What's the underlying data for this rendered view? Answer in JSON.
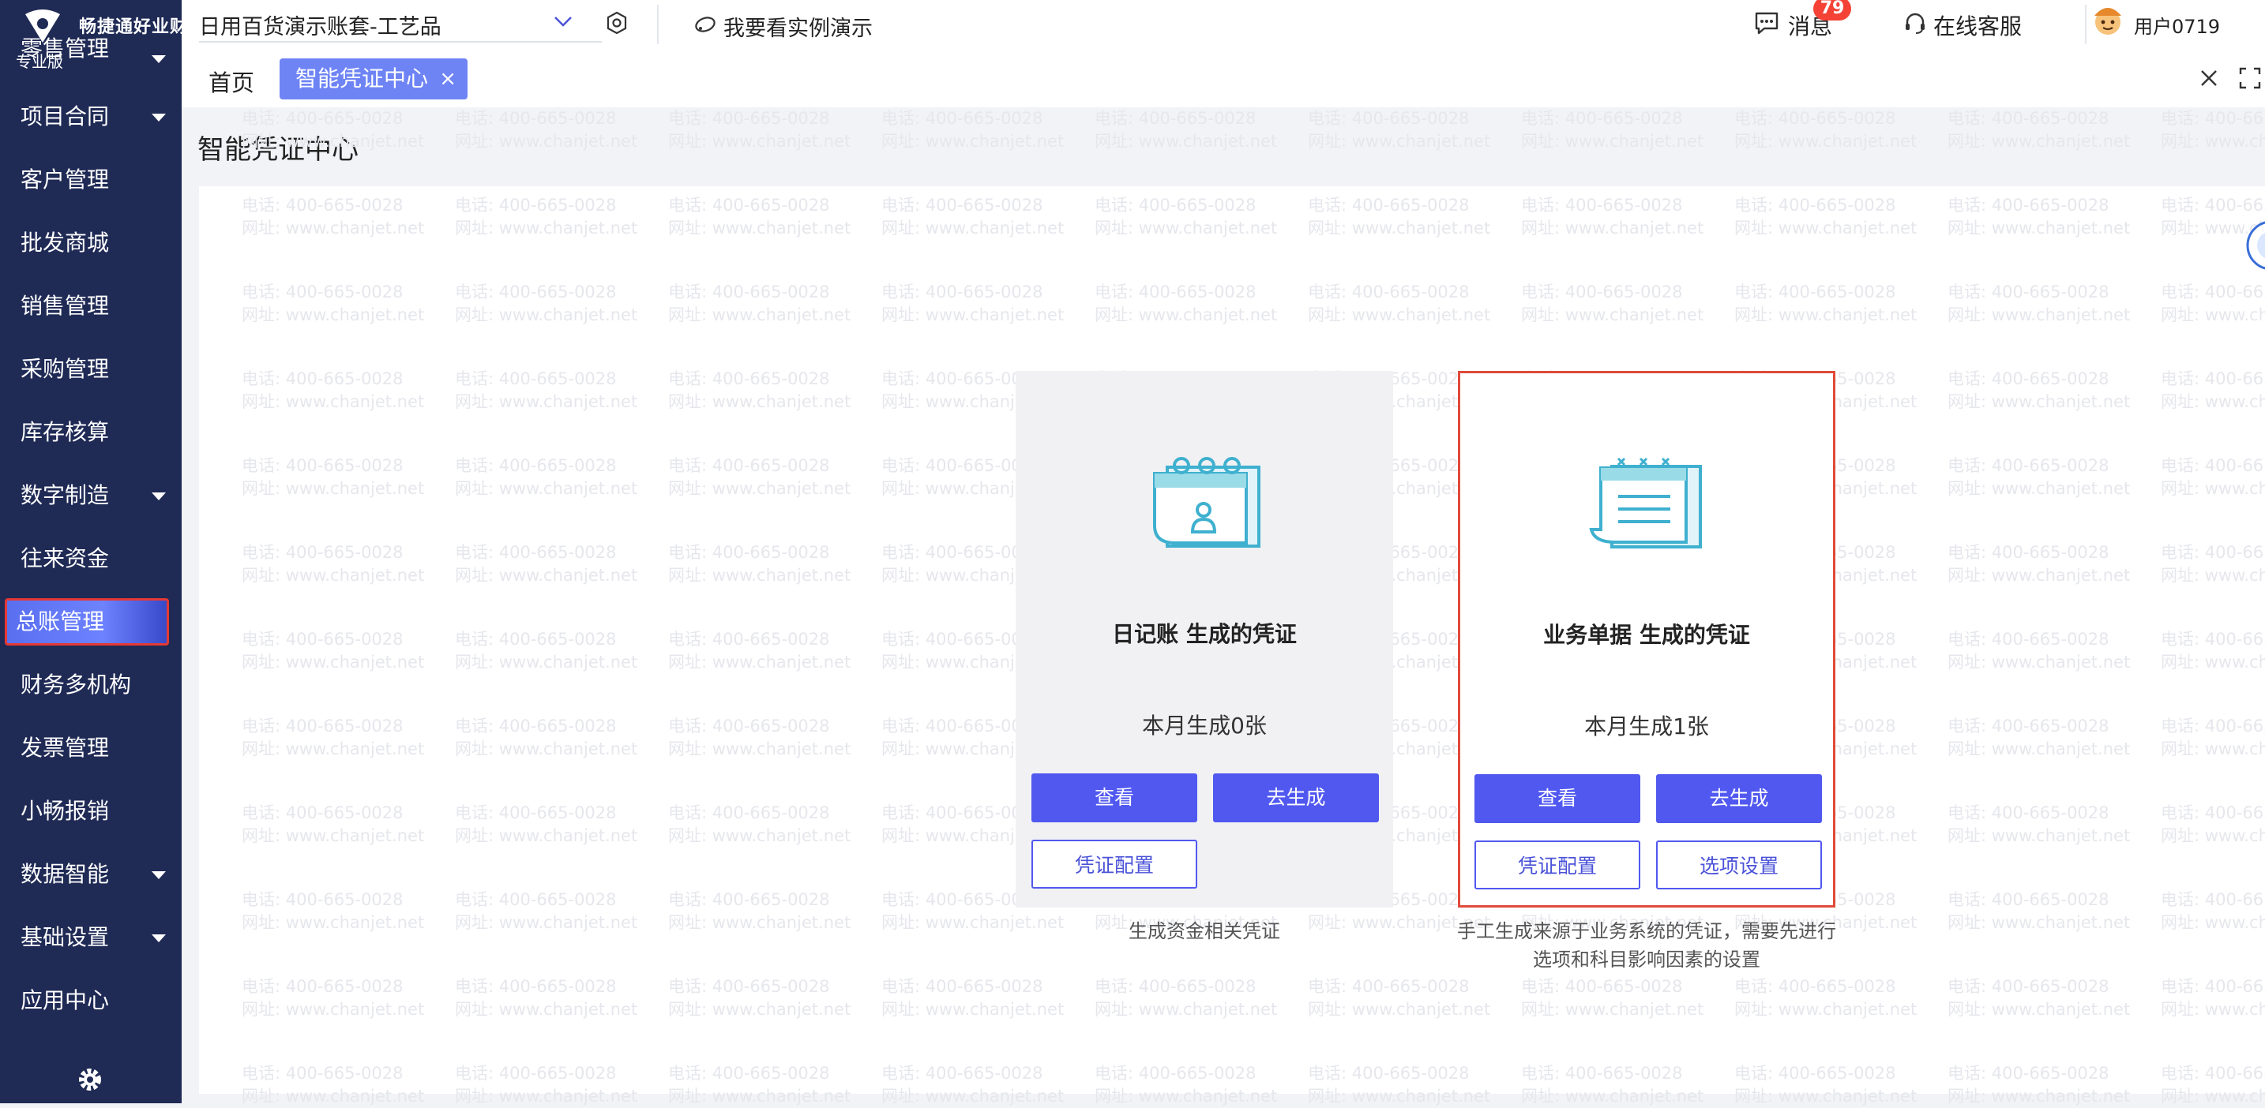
{
  "sidebar": {
    "logo_text": "畅捷通好业财",
    "edition": "专业版",
    "items": [
      {
        "label": "零售管理",
        "has_caret": true
      },
      {
        "label": "项目合同",
        "has_caret": true
      },
      {
        "label": "客户管理",
        "has_caret": false
      },
      {
        "label": "批发商城",
        "has_caret": false
      },
      {
        "label": "销售管理",
        "has_caret": false
      },
      {
        "label": "采购管理",
        "has_caret": false
      },
      {
        "label": "库存核算",
        "has_caret": false
      },
      {
        "label": "数字制造",
        "has_caret": true
      },
      {
        "label": "往来资金",
        "has_caret": false
      },
      {
        "label": "总账管理",
        "has_caret": false,
        "active": true
      },
      {
        "label": "财务多机构",
        "has_caret": false
      },
      {
        "label": "发票管理",
        "has_caret": false
      },
      {
        "label": "小畅报销",
        "has_caret": false
      },
      {
        "label": "数据智能",
        "has_caret": true
      },
      {
        "label": "基础设置",
        "has_caret": true
      },
      {
        "label": "应用中心",
        "has_caret": false
      }
    ]
  },
  "header": {
    "account_name": "日用百货演示账套-工艺品",
    "demo_label": "我要看实例演示",
    "messages_label": "消息",
    "messages_badge": "79",
    "support_label": "在线客服",
    "user_label": "用户0719"
  },
  "tabs": {
    "home": "首页",
    "active": "智能凭证中心",
    "close_glyph": "×"
  },
  "page": {
    "title": "智能凭证中心",
    "watermark_phone": "电话: 400-665-0028",
    "watermark_site": "网址: www.chanjet.net"
  },
  "cards": {
    "left": {
      "title": "日记账 生成的凭证",
      "count": "本月生成0张",
      "view_label": "查看",
      "generate_label": "去生成",
      "config_label": "凭证配置",
      "description": "生成资金相关凭证"
    },
    "right": {
      "title": "业务单据 生成的凭证",
      "count": "本月生成1张",
      "view_label": "查看",
      "generate_label": "去生成",
      "config_label": "凭证配置",
      "options_label": "选项设置",
      "description_line1": "手工生成来源于业务系统的凭证，需要先进行",
      "description_line2": "选项和科目影响因素的设置"
    }
  },
  "colors": {
    "sidebar_bg": "#1f2a55",
    "primary": "#5058f0",
    "tab_active": "#6e84f5",
    "highlight_border": "#e04a3a",
    "badge": "#f44336"
  }
}
